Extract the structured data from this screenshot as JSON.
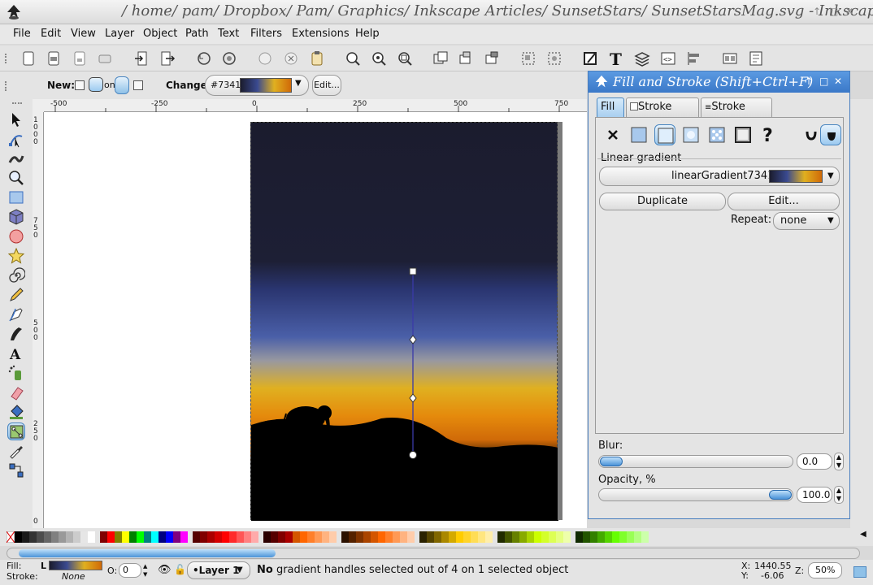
{
  "window": {
    "title": "/ home/ pam/ Dropbox/ Pam/ Graphics/ Inkscape Articles/ SunsetStars/ SunsetStarsMag.svg - Inkscape",
    "controls": [
      "↑",
      "□",
      "✕"
    ]
  },
  "menu": [
    "File",
    "Edit",
    "View",
    "Layer",
    "Object",
    "Path",
    "Text",
    "Filters",
    "Extensions",
    "Help"
  ],
  "tool_controls": {
    "new_label": "New:",
    "on_label": "on",
    "change_label": "Change:",
    "gradient_id_short": "#7341",
    "edit_label": "Edit..."
  },
  "ruler": {
    "h_labels": [
      "-500",
      "-250",
      "0",
      "250",
      "500",
      "750"
    ],
    "v_labels": [
      "1 0 0 0",
      "7 5 0",
      "5 0 0",
      "2 5 0",
      "0"
    ]
  },
  "dialog": {
    "title": "Fill and Stroke (Shift+Ctrl+F)",
    "tabs": {
      "fill": "Fill",
      "stroke_paint": "Stroke paint",
      "stroke_style": "Stroke style"
    },
    "gradient_type_label": "Linear gradient",
    "gradient_name": "linearGradient7341",
    "duplicate_label": "Duplicate",
    "edit_label": "Edit...",
    "repeat_label": "Repeat:",
    "repeat_value": "none",
    "blur_label": "Blur:",
    "blur_value": "0.0",
    "opacity_label": "Opacity, %",
    "opacity_value": "100.0",
    "blur_fraction": 0.0,
    "opacity_fraction": 1.0
  },
  "status": {
    "fill_label": "Fill:",
    "fill_kind": "L",
    "stroke_label": "Stroke:",
    "stroke_value": "None",
    "opacity_label": "O:",
    "opacity_value": "0",
    "layer": "•Layer 1",
    "message_bold": "No",
    "message_rest": "gradient handles selected out of 4 on 1 selected object",
    "x_label": "X:",
    "x_value": "1440.55",
    "y_label": "Y:",
    "y_value": "-6.06",
    "z_label": "Z:",
    "zoom": "50%"
  },
  "colors": {
    "dialog_title": "#4a88d6",
    "gradient_stops": [
      "#1b1c2e",
      "#4a5fa8",
      "#e0b020",
      "#d06a08"
    ]
  }
}
